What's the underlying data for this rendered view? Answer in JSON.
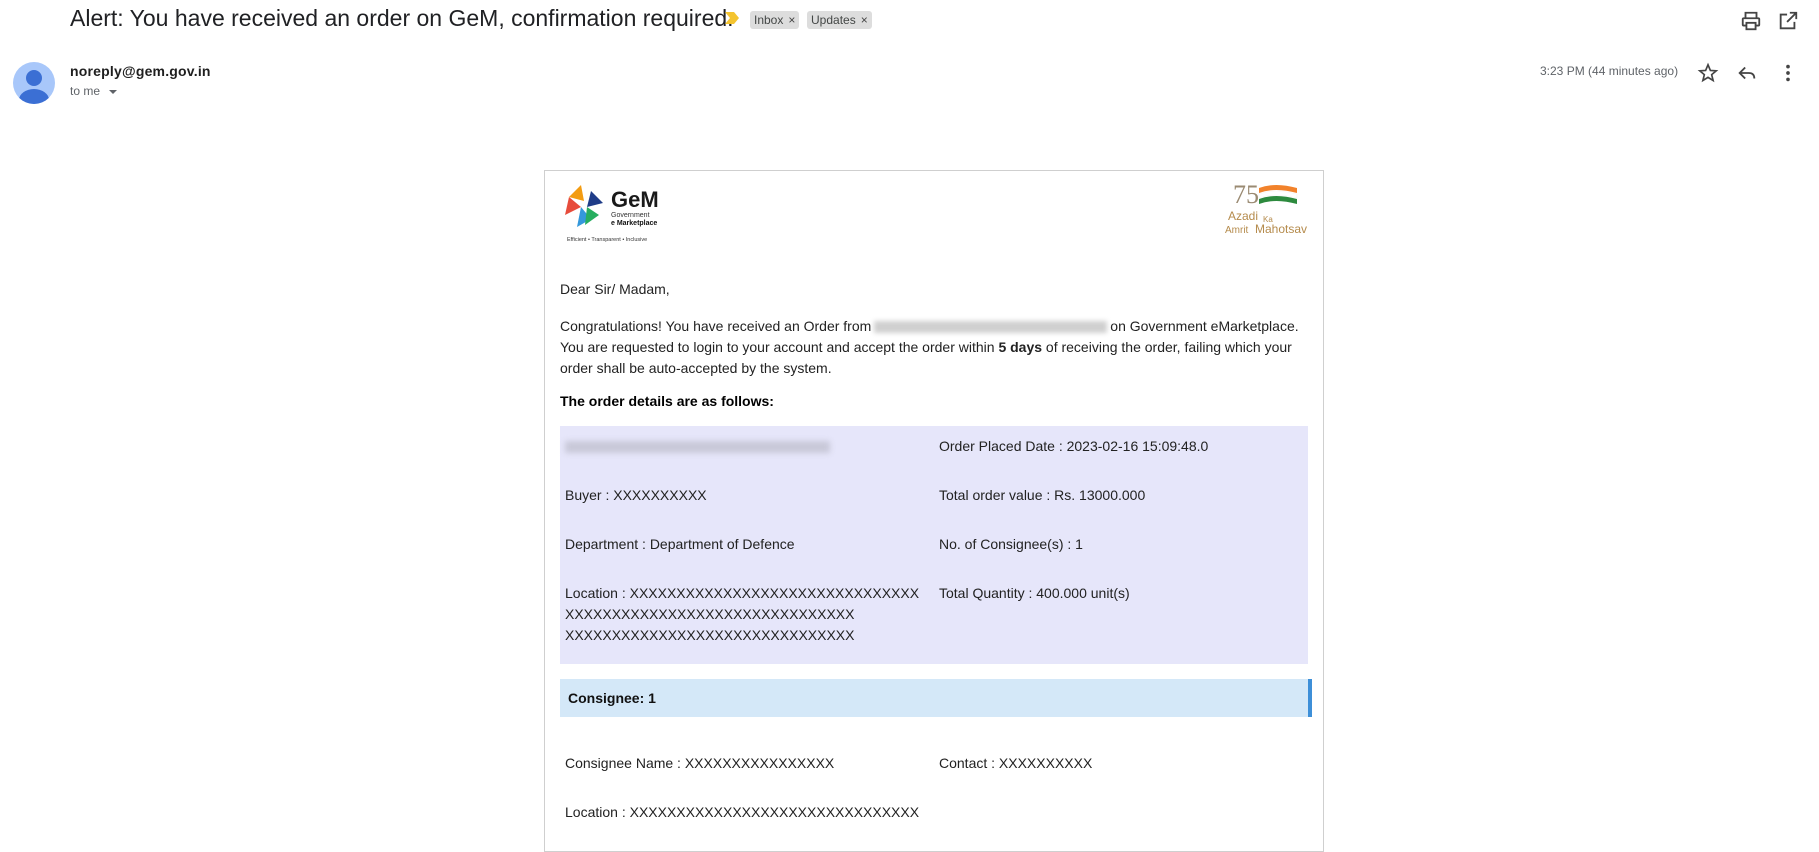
{
  "email": {
    "subject": "Alert: You have received an order on GeM, confirmation required.",
    "labels": [
      {
        "name": "Inbox",
        "remove": "×"
      },
      {
        "name": "Updates",
        "remove": "×"
      }
    ],
    "sender": "noreply@gem.gov.in",
    "to": "to me",
    "timestamp": "3:23 PM (44 minutes ago)",
    "icons": [
      "print-icon",
      "open-in-new-window-icon",
      "star-icon",
      "reply-icon",
      "more-options-icon",
      "important-marker-icon",
      "avatar-icon",
      "dropdown-arrow-icon"
    ]
  },
  "body": {
    "logo_gem": {
      "title": "GeM",
      "line1": "Government",
      "line2": "e Marketplace",
      "tagline": "Efficient • Transparent • Inclusive"
    },
    "logo_azadi": {
      "number": "75",
      "line1": "Azadi",
      "line2": "Ka",
      "line3": "Amrit",
      "line4": "Mahotsav"
    },
    "greeting": "Dear Sir/ Madam,",
    "para_1": "Congratulations! You have received an Order from",
    "para_2": "on Government eMarketplace. You are requested to login to your account and accept the order within",
    "para_bold": "5 days",
    "para_3": "of receiving the order, failing which your order shall be auto-accepted by the system.",
    "details_heading": "The order details are as follows:",
    "details": {
      "order_placed_date": "Order Placed Date : 2023-02-16 15:09:48.0",
      "buyer": "Buyer : XXXXXXXXXX",
      "total_order_value": "Total order value : Rs. 13000.000",
      "department": "Department : Department of Defence",
      "no_of_consignees": "No. of Consignee(s) : 1",
      "location_1": "Location : XXXXXXXXXXXXXXXXXXXXXXXXXXXXXXX",
      "location_2": "XXXXXXXXXXXXXXXXXXXXXXXXXXXXXXX",
      "location_3": "XXXXXXXXXXXXXXXXXXXXXXXXXXXXXXX",
      "total_quantity": "Total Quantity : 400.000 unit(s)"
    },
    "consignee": {
      "title": "Consignee: 1",
      "name": "Consignee Name : XXXXXXXXXXXXXXXX",
      "contact": "Contact : XXXXXXXXXX",
      "location": "Location : XXXXXXXXXXXXXXXXXXXXXXXXXXXXXXX"
    }
  },
  "colors": {
    "details_bg": "#e6e6fa",
    "consignee_bg": "#d4e8f8",
    "consignee_accent": "#3d8fd8",
    "importance_marker": "#f4c430",
    "label_chip": "#dddddd",
    "avatar": "#a8c7fa"
  }
}
